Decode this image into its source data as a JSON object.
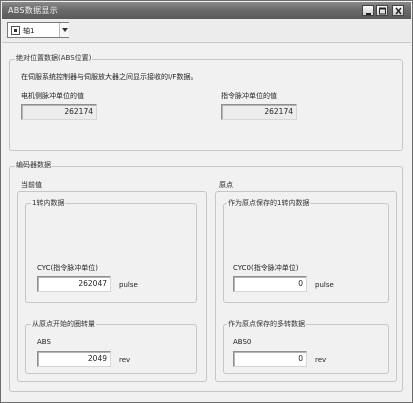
{
  "window": {
    "title": "ABS数据显示",
    "buttons": {
      "minimize": "minimize-icon",
      "maximize": "maximize-icon",
      "close": "close-icon"
    }
  },
  "axis_select": {
    "value": "轴1",
    "icon": "axis-icon"
  },
  "absolute_position": {
    "legend": "绝对位置数据(ABS位置)",
    "description": "在伺服系统控制器与伺服放大器之间显示接收的I/F数据。",
    "motor_side_label": "电机侧脉冲单位的值",
    "motor_side_value": "262174",
    "command_label": "指令脉冲单位的值",
    "command_value": "262174"
  },
  "encoder": {
    "legend": "编码器数据",
    "current": {
      "legend": "当前值",
      "in_rev_legend": "1转内数据",
      "cyc_label": "CYC(指令脉冲单位)",
      "cyc_value": "262047",
      "cyc_unit": "pulse",
      "multi_legend": "从原点开始的圈转量",
      "abs_label": "ABS",
      "abs_value": "2049",
      "abs_unit": "rev"
    },
    "origin": {
      "legend": "原点",
      "in_rev_legend": "作为原点保存的1转内数据",
      "cyc0_label": "CYC0(指令脉冲单位)",
      "cyc0_value": "0",
      "cyc0_unit": "pulse",
      "multi_legend": "作为原点保存的多转数据",
      "abs0_label": "ABS0",
      "abs0_value": "0",
      "abs0_unit": "rev"
    }
  }
}
